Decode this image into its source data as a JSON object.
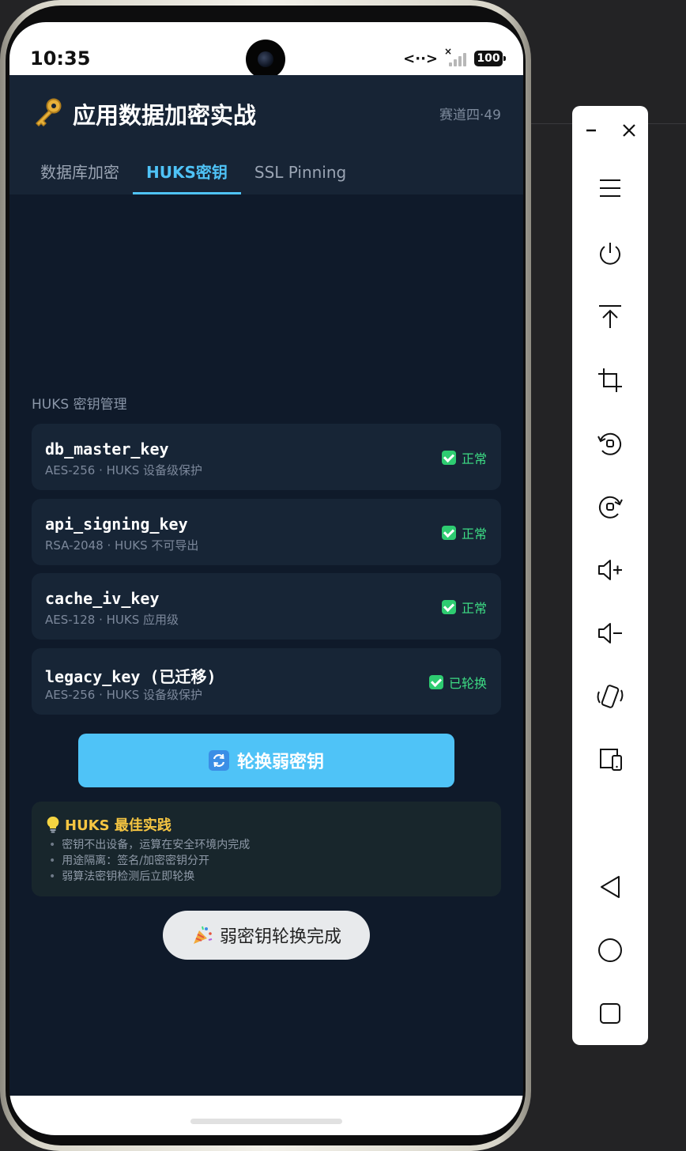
{
  "status_bar": {
    "time": "10:35",
    "data_indicator": "<··>",
    "signal_x": "×",
    "battery": "100"
  },
  "header": {
    "icon": "key-icon",
    "title": "应用数据加密实战",
    "track": "赛道四·49"
  },
  "tabs": [
    {
      "label": "数据库加密",
      "active": false
    },
    {
      "label": "HUKS密钥",
      "active": true
    },
    {
      "label": "SSL Pinning",
      "active": false
    }
  ],
  "section_label": "HUKS 密钥管理",
  "keys": [
    {
      "name": "db_master_key",
      "meta": "AES-256 · HUKS 设备级保护",
      "status": "正常"
    },
    {
      "name": "api_signing_key",
      "meta": "RSA-2048 · HUKS 不可导出",
      "status": "正常"
    },
    {
      "name": "cache_iv_key",
      "meta": "AES-128 · HUKS 应用级",
      "status": "正常"
    },
    {
      "name": "legacy_key (已迁移)",
      "meta": "AES-256 · HUKS 设备级保护",
      "status": "已轮换"
    }
  ],
  "rotate_button": {
    "icon": "rotate-icon",
    "label": "轮换弱密钥"
  },
  "tips": {
    "icon": "lightbulb-icon",
    "title": "HUKS 最佳实践",
    "items": [
      "密钥不出设备，运算在安全环境内完成",
      "用途隔离：签名/加密密钥分开",
      "弱算法密钥检测后立即轮换"
    ]
  },
  "toast": {
    "icon": "party-popper-icon",
    "text": "弱密钥轮换完成"
  },
  "emulator_toolbar": [
    "minimize-icon",
    "close-icon",
    "menu-icon",
    "power-icon",
    "pin-top-icon",
    "crop-icon",
    "rotate-left-icon",
    "rotate-right-icon",
    "volume-up-icon",
    "volume-down-icon",
    "shake-phone-icon",
    "fold-device-icon",
    "back-icon",
    "home-icon",
    "overview-icon"
  ],
  "colors": {
    "accent": "#4fc3f7",
    "status_ok": "#3ddc84",
    "tips_title": "#f5c542",
    "background": "#0f1a2a",
    "card": "#172536"
  }
}
